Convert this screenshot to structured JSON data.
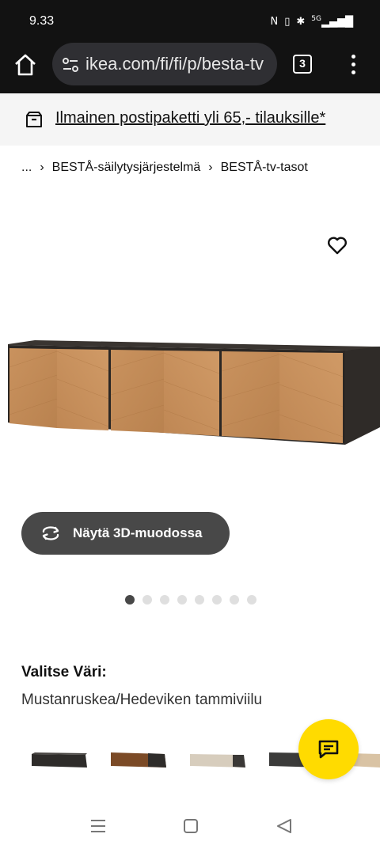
{
  "status_bar": {
    "time": "9.33",
    "icons": [
      "nfc-icon",
      "vibrate-icon",
      "bluetooth-icon",
      "signal-5g-icon"
    ],
    "network_label": "5G"
  },
  "browser": {
    "url": "ikea.com/fi/fi/p/besta-tv",
    "tab_count": "3"
  },
  "promo": {
    "text": "Ilmainen postipaketti yli 65,- tilauksille*"
  },
  "breadcrumb": {
    "items": [
      "...",
      "BESTÅ-säilytysjärjestelmä",
      "BESTÅ-tv-tasot"
    ]
  },
  "product": {
    "view_3d_label": "Näytä 3D-muodossa",
    "image_count": 8,
    "active_image_index": 0
  },
  "color_select": {
    "heading": "Valitse Väri:",
    "selected_value": "Mustanruskea/Hedeviken tammiviilu",
    "swatches": [
      "black-brown",
      "walnut",
      "beige",
      "dark-grey",
      "light-wood"
    ]
  },
  "colors": {
    "system_bar": "#121212",
    "url_box": "#2f2f33",
    "promo_bg": "#f5f5f5",
    "button_dark": "#484848",
    "chat_yellow": "#ffdb00",
    "dot_inactive": "#dfdfdf"
  }
}
